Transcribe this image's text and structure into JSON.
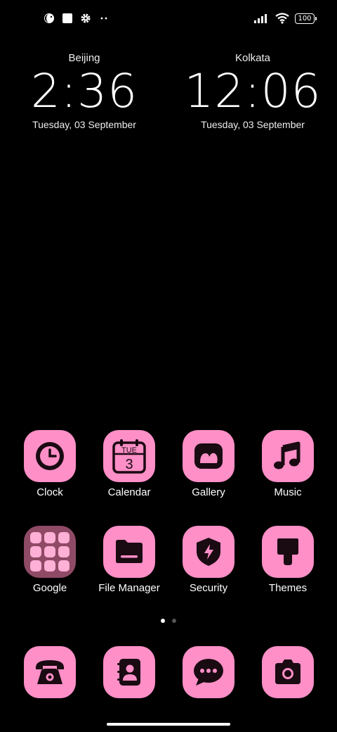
{
  "status_bar": {
    "battery": "100",
    "icons": [
      "moon-face-icon",
      "square-icon",
      "gear-icon",
      "more-dots-icon",
      "signal-icon",
      "wifi-icon",
      "battery-icon"
    ]
  },
  "clocks": [
    {
      "city": "Beijing",
      "time": "2:36",
      "date": "Tuesday, 03 September"
    },
    {
      "city": "Kolkata",
      "time": "12:06",
      "date": "Tuesday, 03 September"
    }
  ],
  "apps": {
    "row1": [
      {
        "label": "Clock",
        "icon": "clock-icon"
      },
      {
        "label": "Calendar",
        "icon": "calendar-icon",
        "day": "TUE",
        "date": "3"
      },
      {
        "label": "Gallery",
        "icon": "gallery-icon"
      },
      {
        "label": "Music",
        "icon": "music-icon"
      }
    ],
    "row2": [
      {
        "label": "Google",
        "icon": "folder-icon"
      },
      {
        "label": "File Manager",
        "icon": "folder-file-icon"
      },
      {
        "label": "Security",
        "icon": "shield-icon"
      },
      {
        "label": "Themes",
        "icon": "brush-icon"
      }
    ]
  },
  "dock": [
    {
      "icon": "phone-icon"
    },
    {
      "icon": "contacts-icon"
    },
    {
      "icon": "messages-icon"
    },
    {
      "icon": "camera-icon"
    }
  ],
  "page_indicator": {
    "pages": 2,
    "current": 1
  },
  "colors": {
    "background": "#000000",
    "icon_bg": "#ff8fc7",
    "glyph": "#1a0a12",
    "folder_bg": "#8f4a66"
  }
}
